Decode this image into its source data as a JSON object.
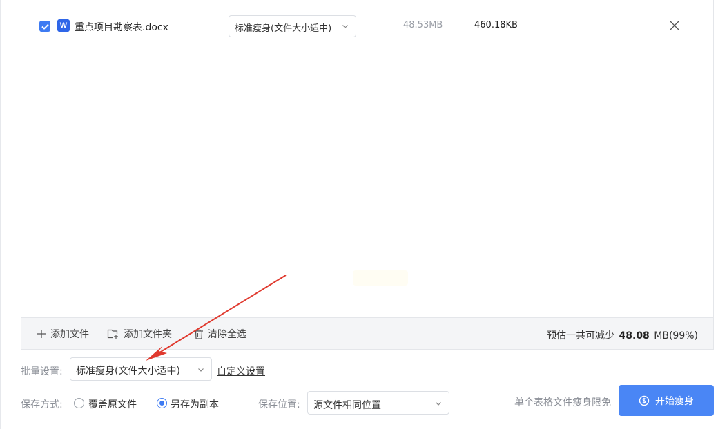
{
  "file_list": {
    "rows": [
      {
        "checked": true,
        "file_icon": "word-doc-icon",
        "name": "重点项目勘察表.docx",
        "mode": "标准瘦身(文件大小适中)",
        "original_size": "48.53MB",
        "compressed_size": "460.18KB"
      }
    ]
  },
  "toolbar": {
    "add_file": "添加文件",
    "add_folder": "添加文件夹",
    "clear_all": "清除全选",
    "estimate_prefix": "预估一共可减少",
    "estimate_value": "48.08",
    "estimate_suffix": "MB(99%)"
  },
  "batch": {
    "label": "批量设置:",
    "selected": "标准瘦身(文件大小适中)",
    "custom_link": "自定义设置"
  },
  "save": {
    "label": "保存方式:",
    "option_overwrite": "覆盖原文件",
    "option_copy": "另存为副本",
    "selected": "另存为副本"
  },
  "location": {
    "label": "保存位置:",
    "selected": "源文件相同位置"
  },
  "footer": {
    "free_note": "单个表格文件瘦身限免",
    "start_button": "开始瘦身"
  },
  "colors": {
    "accent": "#4a86f5",
    "checkbox": "#3e7bf2",
    "word_icon": "#2f66e8",
    "annotation_arrow": "#e03a2f"
  }
}
